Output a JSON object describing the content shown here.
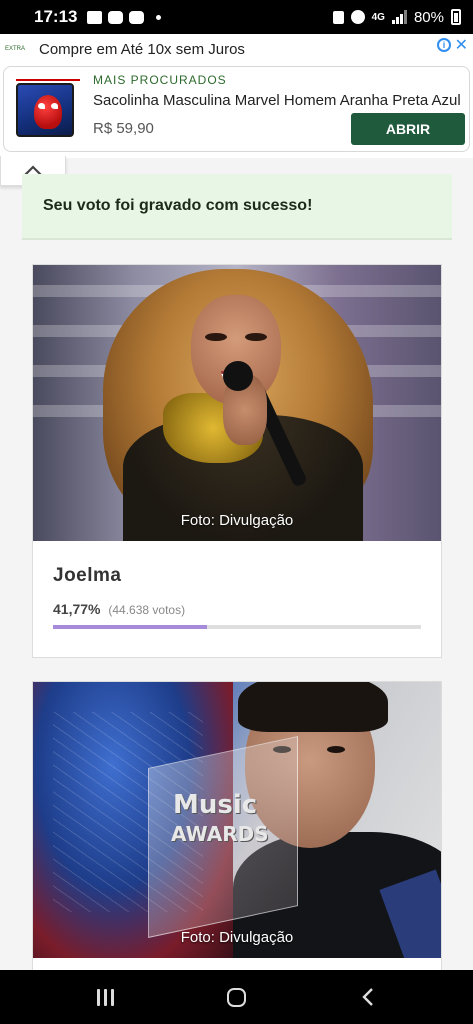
{
  "status_bar": {
    "time": "17:13",
    "network": "4G",
    "battery": "80%"
  },
  "ad": {
    "headline": "Compre em Até 10x sem Juros",
    "logo_text": "EXTRA",
    "kicker": "MAIS PROCURADOS",
    "title": "Sacolinha Masculina Marvel Homem Aranha Preta Azul",
    "price": "R$ 59,90",
    "cta": "ABRIR",
    "info_icon": "info-icon",
    "close_icon": "close-icon"
  },
  "collapse": {
    "icon": "chevron-up-icon"
  },
  "success_message": "Seu voto foi gravado com sucesso!",
  "candidates": [
    {
      "name": "Joelma",
      "percent": "41,77%",
      "percent_value": 41.77,
      "votes": "(44.638 votos)",
      "photo_credit": "Foto: Divulgação"
    },
    {
      "photo_credit": "Foto: Divulgação",
      "photo_text_1": "Music",
      "photo_text_2": "AWARDS"
    }
  ],
  "colors": {
    "success_bg": "#e8f6e6",
    "progress_fill": "#a78bdb",
    "cta_bg": "#1f5a3c"
  },
  "nav": {
    "recent_icon": "recent-apps-icon",
    "home_icon": "home-icon",
    "back_icon": "back-icon"
  }
}
